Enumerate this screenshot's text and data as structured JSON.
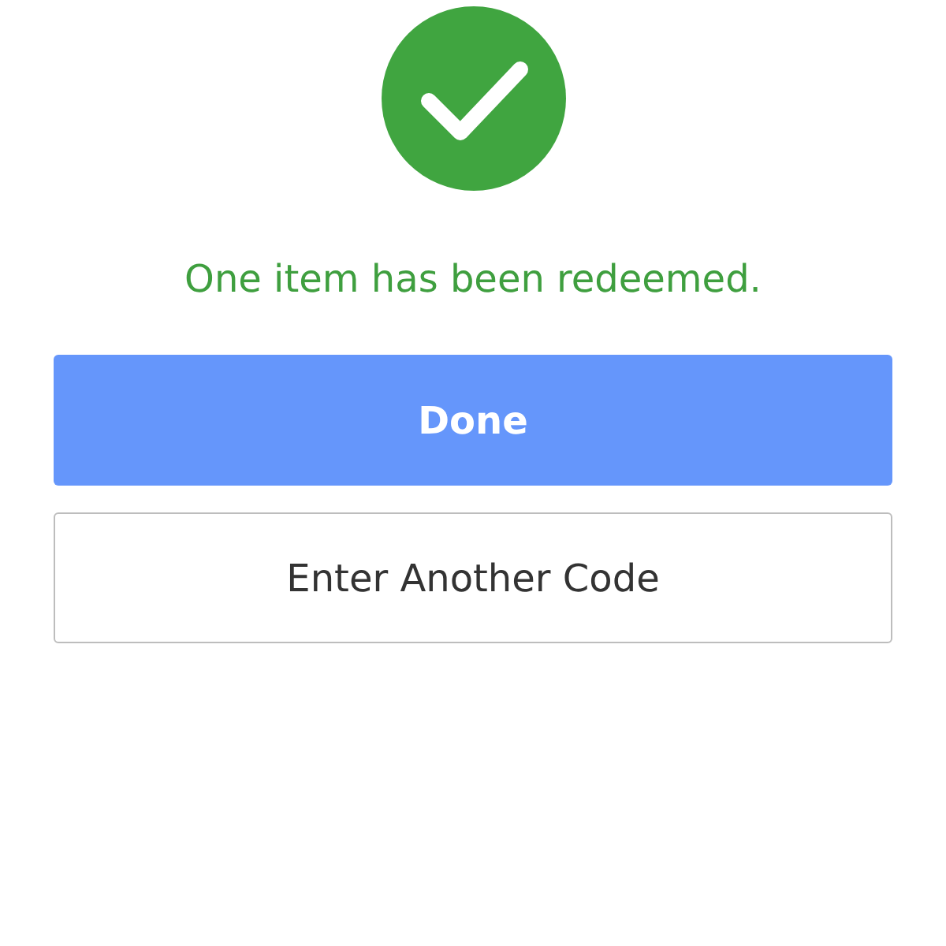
{
  "message": "One item has been redeemed.",
  "buttons": [
    {
      "label": "Done",
      "kind": "primary"
    },
    {
      "label": "Enter Another Code",
      "kind": "secondary"
    }
  ]
}
